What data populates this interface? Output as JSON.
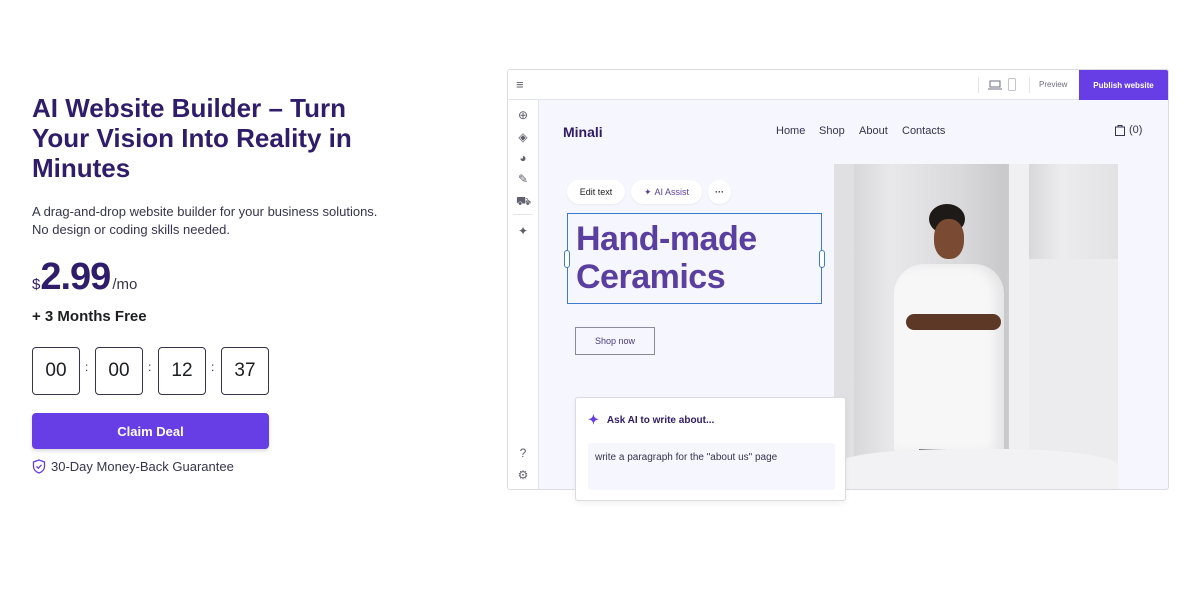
{
  "hero": {
    "title": "AI Website Builder – Turn Your Vision Into Reality in Minutes",
    "description_line1": "A drag-and-drop website builder for your business solutions.",
    "description_line2": "No design or coding skills needed.",
    "price": {
      "currency": "$",
      "amount": "2.99",
      "period": "/mo"
    },
    "bonus": "+ 3 Months Free",
    "countdown": [
      "00",
      "00",
      "12",
      "37"
    ],
    "countdown_separator": ":",
    "cta_label": "Claim Deal",
    "guarantee": "30-Day Money-Back Guarantee",
    "accent_color": "#673de6"
  },
  "builder": {
    "topbar": {
      "preview_label": "Preview",
      "publish_label": "Publish website"
    },
    "sidebar_icons": [
      "menu-icon",
      "add-icon",
      "layers-icon",
      "palette-icon",
      "edit-icon",
      "cart-icon",
      "sparkle-icon",
      "help-icon",
      "settings-icon"
    ],
    "site": {
      "logo": "Minali",
      "nav": [
        "Home",
        "Shop",
        "About",
        "Contacts"
      ],
      "cart_count": "(0)",
      "heading_line1": "Hand-made",
      "heading_line2": "Ceramics",
      "shop_button": "Shop now"
    },
    "toolbar": {
      "edit_text": "Edit text",
      "ai_assist": "AI Assist",
      "more": "···"
    },
    "ai_panel": {
      "title": "Ask AI to write about...",
      "prompt": "write a paragraph for the \"about us\" page"
    }
  }
}
